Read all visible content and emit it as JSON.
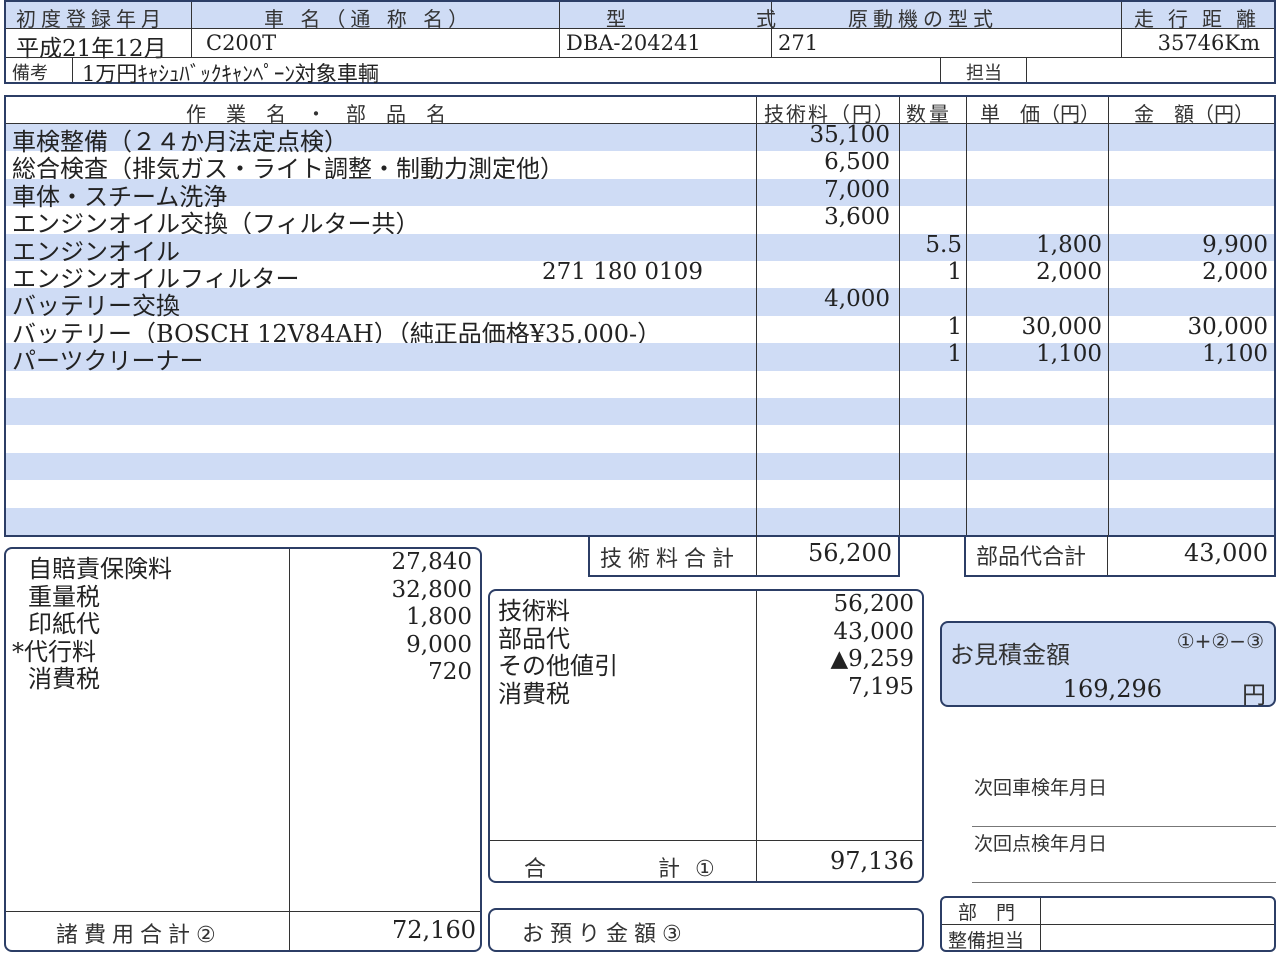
{
  "vehicle": {
    "headers": {
      "reg_date": "初度登録年月",
      "car_name": "車 名（通 称 名）",
      "model": "型　　式",
      "engine": "原動機の型式",
      "mileage": "走行距離"
    },
    "reg_date": "平成21年12月",
    "car_name": "C200T",
    "model": "DBA-204241",
    "engine": "271",
    "mileage": "35746Km",
    "remark_label": "備考",
    "remark": "1万円ｷｬｼｭﾊﾞｯｸｷｬﾝﾍﾟｰﾝ対象車輌",
    "staff_label": "担当",
    "staff": ""
  },
  "work": {
    "headers": {
      "name": "作　業　名　・　部　品　名",
      "labor": "技術料（円）",
      "qty": "数量",
      "unit": "単　価（円）",
      "amount": "金　額（円）"
    },
    "rows": [
      {
        "name": "車検整備（２４か月法定点検）",
        "part_no": "",
        "labor": "35,100",
        "qty": "",
        "unit": "",
        "amount": ""
      },
      {
        "name": "総合検査（排気ガス・ライト調整・制動力測定他）",
        "part_no": "",
        "labor": "6,500",
        "qty": "",
        "unit": "",
        "amount": ""
      },
      {
        "name": "車体・スチーム洗浄",
        "part_no": "",
        "labor": "7,000",
        "qty": "",
        "unit": "",
        "amount": ""
      },
      {
        "name": "エンジンオイル交換（フィルター共）",
        "part_no": "",
        "labor": "3,600",
        "qty": "",
        "unit": "",
        "amount": ""
      },
      {
        "name": "エンジンオイル",
        "part_no": "",
        "labor": "",
        "qty": "5.5",
        "unit": "1,800",
        "amount": "9,900"
      },
      {
        "name": "エンジンオイルフィルター",
        "part_no": "271 180 0109",
        "labor": "",
        "qty": "1",
        "unit": "2,000",
        "amount": "2,000"
      },
      {
        "name": "バッテリー交換",
        "part_no": "",
        "labor": "4,000",
        "qty": "",
        "unit": "",
        "amount": ""
      },
      {
        "name": "バッテリー（BOSCH 12V84AH）（純正品価格¥35,000-）",
        "part_no": "",
        "labor": "",
        "qty": "1",
        "unit": "30,000",
        "amount": "30,000"
      },
      {
        "name": "パーツクリーナー",
        "part_no": "",
        "labor": "",
        "qty": "1",
        "unit": "1,100",
        "amount": "1,100"
      }
    ],
    "labor_total_label": "技術料合計",
    "labor_total": "56,200",
    "parts_total_label": "部品代合計",
    "parts_total": "43,000"
  },
  "fees": {
    "items": [
      {
        "label": "自賠責保険料",
        "value": "27,840"
      },
      {
        "label": "重量税",
        "value": "32,800"
      },
      {
        "label": "印紙代",
        "value": "1,800"
      },
      {
        "label": "*代行料",
        "value": "9,000"
      },
      {
        "label": "消費税",
        "value": "720"
      }
    ],
    "total_label": "諸費用合計②",
    "total": "72,160"
  },
  "summary": {
    "items": [
      {
        "label": "技術料",
        "value": "56,200"
      },
      {
        "label": "部品代",
        "value": "43,000"
      },
      {
        "label": "その他値引",
        "value": "▲9,259"
      },
      {
        "label": "消費税",
        "value": "7,195"
      }
    ],
    "total_label_a": "合",
    "total_label_b": "計 ①",
    "total": "97,136",
    "deposit_label": "お預り金額③"
  },
  "estimate": {
    "label": "お見積金額",
    "formula": "①+②−③",
    "value": "169,296",
    "unit": "円"
  },
  "next": {
    "inspection_label": "次回車検年月日",
    "check_label": "次回点検年月日"
  },
  "dept": {
    "dept_label": "部　門",
    "mech_label": "整備担当"
  }
}
